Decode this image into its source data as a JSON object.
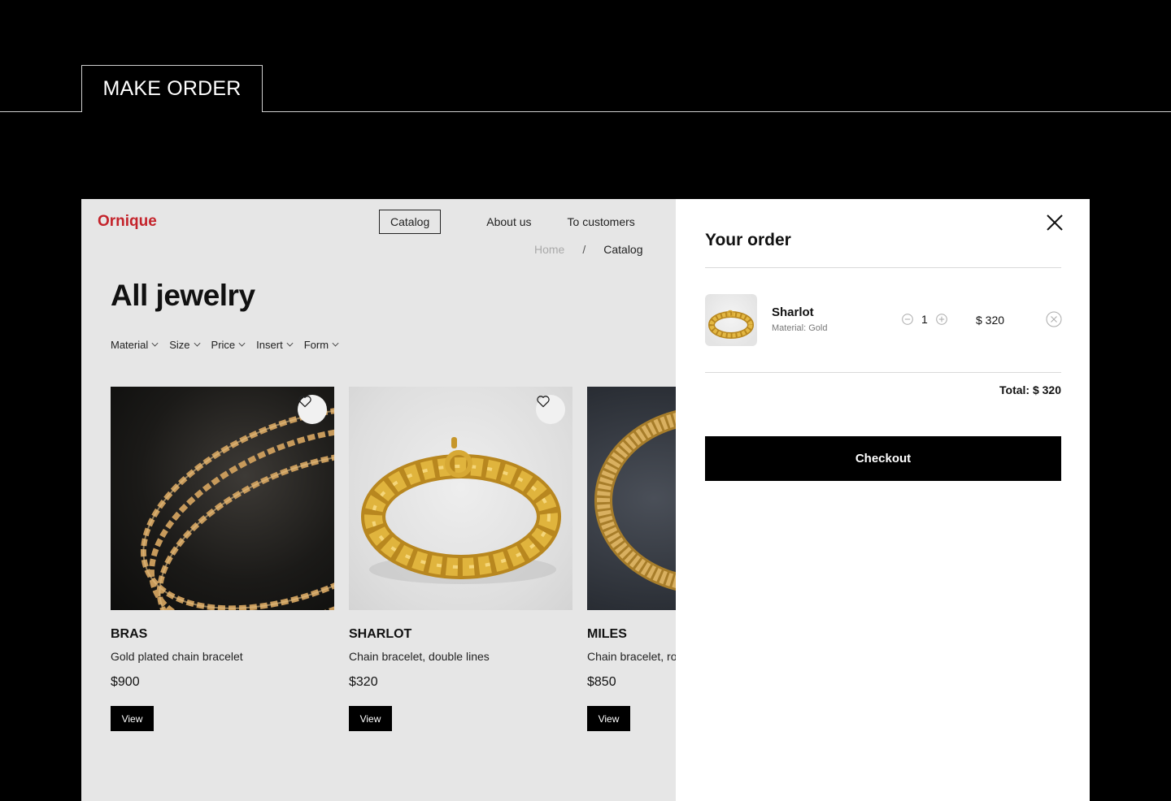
{
  "section_tab": "MAKE ORDER",
  "site": {
    "logo": "Ornique",
    "nav": [
      "Catalog",
      "About us",
      "To customers"
    ],
    "breadcrumb": {
      "home": "Home",
      "separator": "/",
      "current": "Catalog"
    },
    "title": "All jewelry",
    "filters": [
      "Material",
      "Size",
      "Price",
      "Insert",
      "Form"
    ],
    "products": [
      {
        "name": "BRAS",
        "desc": "Gold plated chain bracelet",
        "price": "$900",
        "button": "View",
        "favorite_icon": "heart-icon"
      },
      {
        "name": "SHARLOT",
        "desc": "Chain bracelet, double lines",
        "price": "$320",
        "button": "View",
        "favorite_icon": "heart-icon"
      },
      {
        "name": "MILES",
        "desc": "Chain bracelet, ro",
        "price": "$850",
        "button": "View"
      }
    ]
  },
  "order": {
    "title": "Your order",
    "item": {
      "name": "Sharlot",
      "material": "Material: Gold",
      "quantity": "1",
      "price": "$ 320"
    },
    "total": "Total: $ 320",
    "checkout": "Checkout"
  },
  "colors": {
    "brand": "#c4232b",
    "panel_bg": "#ffffff",
    "site_bg": "#e6e6e6",
    "button": "#000000"
  }
}
